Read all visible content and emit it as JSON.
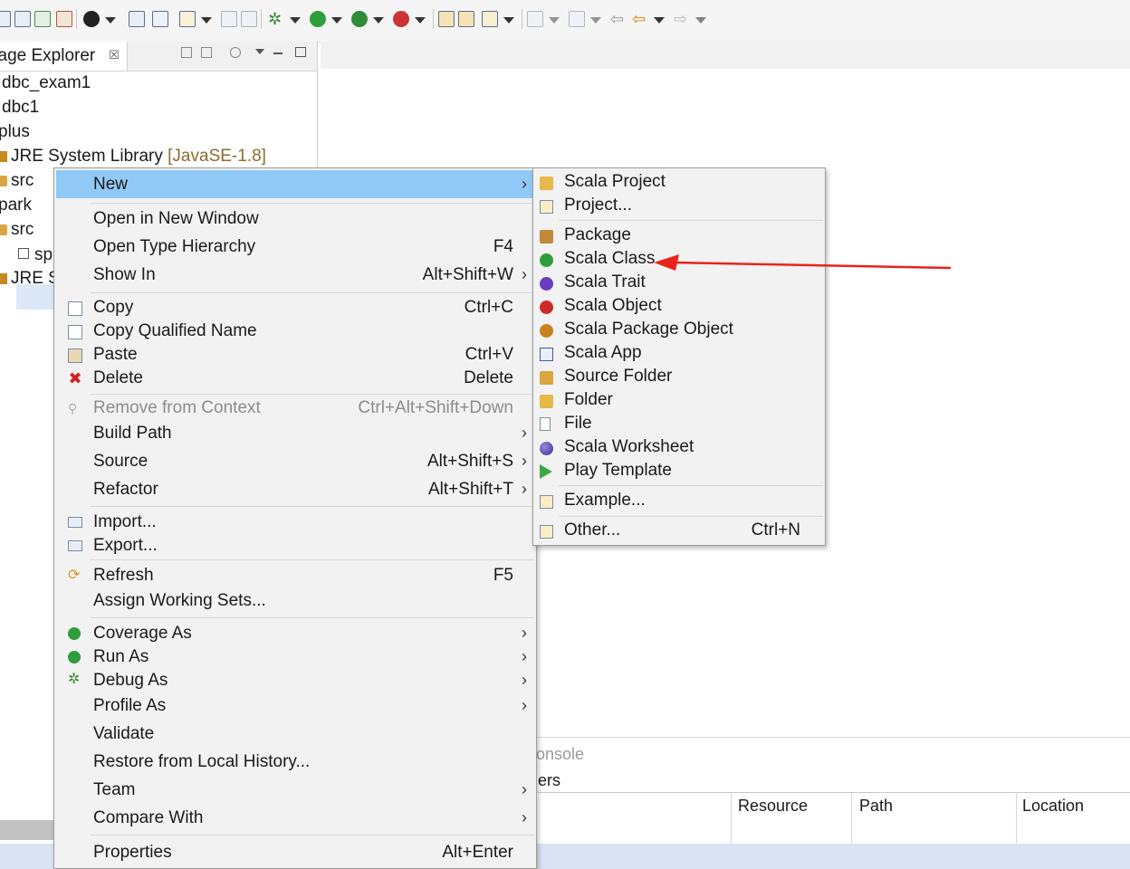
{
  "package_explorer": {
    "tab_title": "kage Explorer",
    "close_glyph": "☒",
    "tree": [
      {
        "label": "dbc_exam1"
      },
      {
        "label": "dbc1"
      },
      {
        "label": "plus"
      },
      {
        "label": "JRE System Library",
        "suffix": "[JavaSE-1.8]"
      },
      {
        "label": "src"
      },
      {
        "label": "park"
      },
      {
        "label": "src"
      },
      {
        "label": "sp"
      },
      {
        "label": "JRE S"
      }
    ]
  },
  "context_menu": {
    "items": [
      {
        "label": "New",
        "accel": "",
        "submenu": true,
        "icon": "none",
        "selected": true
      },
      {
        "label": "Open in New Window",
        "accel": "",
        "icon": "none"
      },
      {
        "label": "Open Type Hierarchy",
        "accel": "F4",
        "icon": "none"
      },
      {
        "label": "Show In",
        "accel": "Alt+Shift+W",
        "submenu": true,
        "icon": "none"
      },
      {
        "label": "Copy",
        "accel": "Ctrl+C",
        "icon": "copy-icon"
      },
      {
        "label": "Copy Qualified Name",
        "accel": "",
        "icon": "copy-qualified-icon"
      },
      {
        "label": "Paste",
        "accel": "Ctrl+V",
        "icon": "paste-icon"
      },
      {
        "label": "Delete",
        "accel": "Delete",
        "icon": "delete-icon"
      },
      {
        "label": "Remove from Context",
        "accel": "Ctrl+Alt+Shift+Down",
        "icon": "remove-context-icon",
        "disabled": true
      },
      {
        "label": "Build Path",
        "accel": "",
        "submenu": true,
        "icon": "none"
      },
      {
        "label": "Source",
        "accel": "Alt+Shift+S",
        "submenu": true,
        "icon": "none"
      },
      {
        "label": "Refactor",
        "accel": "Alt+Shift+T",
        "submenu": true,
        "icon": "none"
      },
      {
        "label": "Import...",
        "accel": "",
        "icon": "import-icon"
      },
      {
        "label": "Export...",
        "accel": "",
        "icon": "export-icon"
      },
      {
        "label": "Refresh",
        "accel": "F5",
        "icon": "refresh-icon"
      },
      {
        "label": "Assign Working Sets...",
        "accel": "",
        "icon": "none"
      },
      {
        "label": "Coverage As",
        "accel": "",
        "submenu": true,
        "icon": "coverage-icon"
      },
      {
        "label": "Run As",
        "accel": "",
        "submenu": true,
        "icon": "run-icon"
      },
      {
        "label": "Debug As",
        "accel": "",
        "submenu": true,
        "icon": "debug-icon"
      },
      {
        "label": "Profile As",
        "accel": "",
        "submenu": true,
        "icon": "none"
      },
      {
        "label": "Validate",
        "accel": "",
        "icon": "none"
      },
      {
        "label": "Restore from Local History...",
        "accel": "",
        "icon": "none"
      },
      {
        "label": "Team",
        "accel": "",
        "submenu": true,
        "icon": "none"
      },
      {
        "label": "Compare With",
        "accel": "",
        "submenu": true,
        "icon": "none"
      },
      {
        "label": "Properties",
        "accel": "Alt+Enter",
        "icon": "none"
      }
    ],
    "submenu_arrow": "›"
  },
  "new_submenu": {
    "items": [
      {
        "label": "Scala Project",
        "accel": "",
        "icon": "scala-project-icon"
      },
      {
        "label": "Project...",
        "accel": "",
        "icon": "project-icon"
      },
      {
        "label": "Package",
        "accel": "",
        "icon": "package-icon"
      },
      {
        "label": "Scala Class",
        "accel": "",
        "icon": "scala-class-icon"
      },
      {
        "label": "Scala Trait",
        "accel": "",
        "icon": "scala-trait-icon"
      },
      {
        "label": "Scala Object",
        "accel": "",
        "icon": "scala-object-icon"
      },
      {
        "label": "Scala Package Object",
        "accel": "",
        "icon": "scala-package-object-icon"
      },
      {
        "label": "Scala App",
        "accel": "",
        "icon": "scala-app-icon"
      },
      {
        "label": "Source Folder",
        "accel": "",
        "icon": "source-folder-icon"
      },
      {
        "label": "Folder",
        "accel": "",
        "icon": "folder-icon"
      },
      {
        "label": "File",
        "accel": "",
        "icon": "file-icon"
      },
      {
        "label": "Scala Worksheet",
        "accel": "",
        "icon": "scala-worksheet-icon"
      },
      {
        "label": "Play Template",
        "accel": "",
        "icon": "play-template-icon"
      },
      {
        "label": "Example...",
        "accel": "",
        "icon": "example-icon"
      },
      {
        "label": "Other...",
        "accel": "Ctrl+N",
        "icon": "other-icon"
      }
    ]
  },
  "bottom_panel": {
    "console_tab": "onsole",
    "filters_label": "ers",
    "columns": [
      "Resource",
      "Path",
      "Location"
    ]
  },
  "annotation": {
    "color": "#e8231b",
    "target": "Scala Class"
  }
}
